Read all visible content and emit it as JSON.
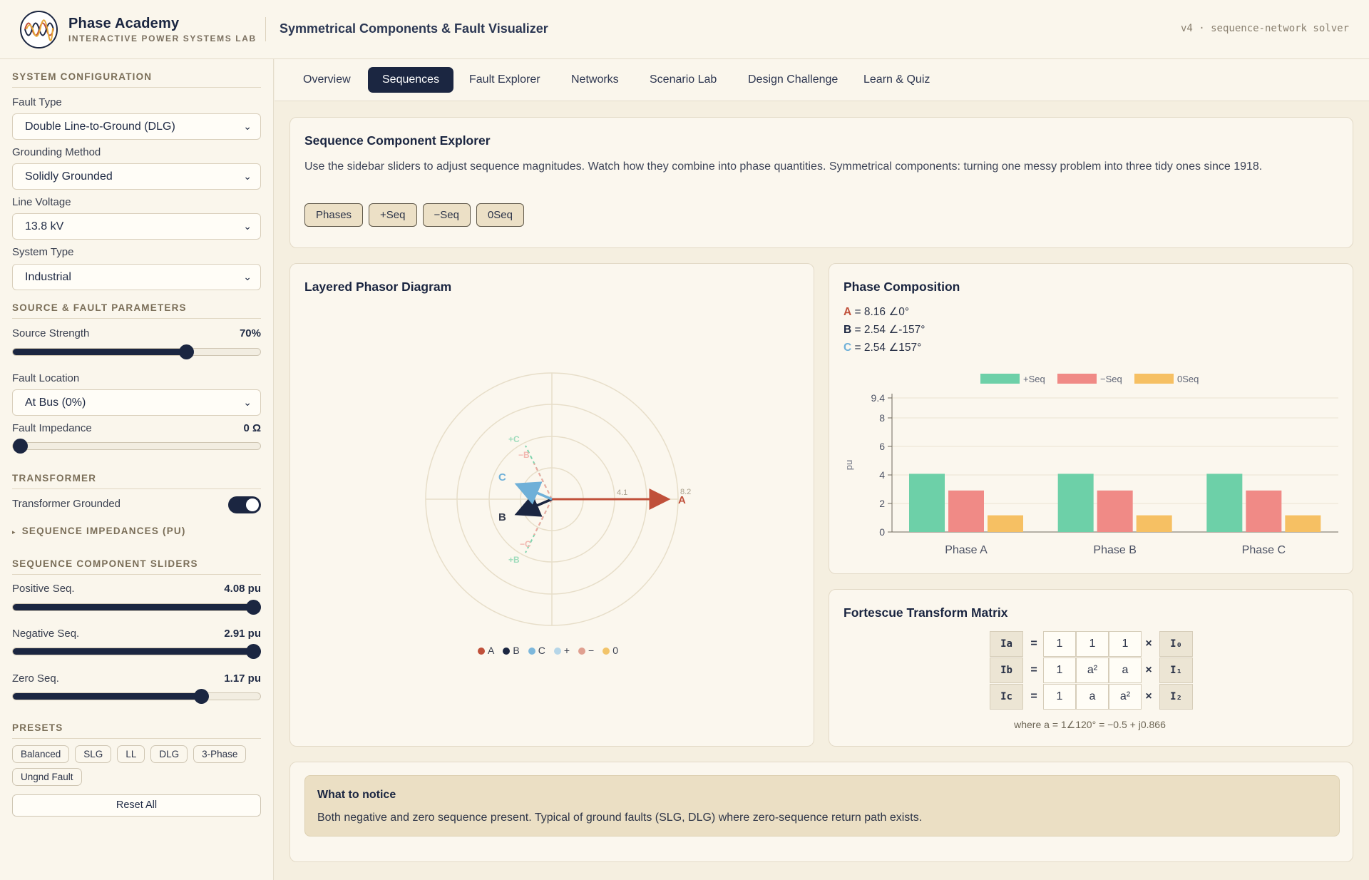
{
  "header": {
    "brand_name": "Phase Academy",
    "brand_sub": "INTERACTIVE POWER SYSTEMS LAB",
    "app_title": "Symmetrical Components & Fault Visualizer",
    "version": "v4 · sequence-network solver"
  },
  "sidebar": {
    "system_config": {
      "heading": "SYSTEM CONFIGURATION",
      "fault_type_label": "Fault Type",
      "fault_type_value": "Double Line-to-Ground (DLG)",
      "grounding_label": "Grounding Method",
      "grounding_value": "Solidly Grounded",
      "line_voltage_label": "Line Voltage",
      "line_voltage_value": "13.8 kV",
      "system_type_label": "System Type",
      "system_type_value": "Industrial"
    },
    "source_fault": {
      "heading": "SOURCE & FAULT PARAMETERS",
      "source_strength_label": "Source Strength",
      "source_strength_value": "70%",
      "source_strength_fraction": 0.7,
      "fault_location_label": "Fault Location",
      "fault_location_value": "At Bus (0%)",
      "fault_impedance_label": "Fault Impedance",
      "fault_impedance_value": "0 Ω",
      "fault_impedance_fraction": 0.0
    },
    "transformer": {
      "heading": "TRANSFORMER",
      "grounded_label": "Transformer Grounded",
      "grounded_on": true,
      "seq_impedances": "SEQUENCE IMPEDANCES (PU)"
    },
    "sliders": {
      "heading": "SEQUENCE COMPONENT SLIDERS",
      "positive_label": "Positive Seq.",
      "positive_value": "4.08 pu",
      "positive_fraction": 1.0,
      "negative_label": "Negative Seq.",
      "negative_value": "2.91 pu",
      "negative_fraction": 1.0,
      "zero_label": "Zero Seq.",
      "zero_value": "1.17 pu",
      "zero_fraction": 0.76
    },
    "presets": {
      "heading": "PRESETS",
      "items": [
        "Balanced",
        "SLG",
        "LL",
        "DLG",
        "3-Phase",
        "Ungnd Fault"
      ],
      "reset_label": "Reset All"
    }
  },
  "tabs": [
    "Overview",
    "Sequences",
    "Fault Explorer",
    "Networks",
    "Scenario Lab",
    "Design Challenge",
    "Learn & Quiz"
  ],
  "active_tab": "Sequences",
  "explorer": {
    "title": "Sequence Component Explorer",
    "description": "Use the sidebar sliders to adjust sequence magnitudes. Watch how they combine into phase quantities. Symmetrical components: turning one messy problem into three tidy ones since 1918.",
    "chips": [
      "Phases",
      "+Seq",
      "−Seq",
      "0Seq"
    ]
  },
  "phasor": {
    "title": "Layered Phasor Diagram",
    "labels": {
      "a": "A",
      "b": "B",
      "c": "C",
      "pos_c": "+C",
      "pos_b": "+B",
      "neg_b": "−B",
      "neg_c": "−C",
      "mag_pos": "4.1",
      "mag_total": "8.2"
    },
    "legend": [
      {
        "label": "A",
        "color": "#c0503a"
      },
      {
        "label": "B",
        "color": "#1b2641"
      },
      {
        "label": "C",
        "color": "#7db8dc"
      },
      {
        "label": "+",
        "color": "#b6d6e8"
      },
      {
        "label": "−",
        "color": "#e0a090"
      },
      {
        "label": "0",
        "color": "#f2c46a"
      }
    ],
    "colors": {
      "A": "#c0503a",
      "B": "#1b2641",
      "C": "#6fb0d8",
      "pos": "#7fd3ad",
      "neg": "#f0a8a0",
      "zero": "#f2c46a"
    },
    "phasors": [
      {
        "name": "A",
        "mag": 8.16,
        "angle": 0
      },
      {
        "name": "B",
        "mag": 2.54,
        "angle": -157
      },
      {
        "name": "C",
        "mag": 2.54,
        "angle": 157
      }
    ]
  },
  "composition": {
    "title": "Phase Composition",
    "lines": [
      {
        "name": "A",
        "text": " = 8.16 ∠0°",
        "color": "#c0503a"
      },
      {
        "name": "B",
        "text": " = 2.54 ∠-157°",
        "color": "#1b2641"
      },
      {
        "name": "C",
        "text": " = 2.54 ∠157°",
        "color": "#6fb0d8"
      }
    ]
  },
  "chart_data": {
    "type": "bar",
    "categories": [
      "Phase A",
      "Phase B",
      "Phase C"
    ],
    "series": [
      {
        "name": "+Seq",
        "values": [
          4.08,
          4.08,
          4.08
        ],
        "color": "#6dd0a8"
      },
      {
        "name": "−Seq",
        "values": [
          2.91,
          2.91,
          2.91
        ],
        "color": "#f08a86"
      },
      {
        "name": "0Seq",
        "values": [
          1.17,
          1.17,
          1.17
        ],
        "color": "#f6c063"
      }
    ],
    "ylabel": "pu",
    "yticks": [
      0,
      2,
      4,
      6,
      8,
      9.4
    ],
    "ylim": [
      0,
      9.4
    ],
    "legend": "top",
    "grid": true
  },
  "fortescue": {
    "title": "Fortescue Transform Matrix",
    "rows": [
      {
        "lhs": "Ia",
        "cells": [
          "1",
          "1",
          "1"
        ],
        "rhs": "I₀"
      },
      {
        "lhs": "Ib",
        "cells": [
          "1",
          "a²",
          "a"
        ],
        "rhs": "I₁"
      },
      {
        "lhs": "Ic",
        "cells": [
          "1",
          "a",
          "a²"
        ],
        "rhs": "I₂"
      }
    ],
    "eq": "=",
    "times": "×",
    "note": "where a = 1∠120° = −0.5 + j0.866"
  },
  "notice": {
    "title": "What to notice",
    "text": "Both negative and zero sequence present. Typical of ground faults (SLG, DLG) where zero-sequence return path exists."
  }
}
